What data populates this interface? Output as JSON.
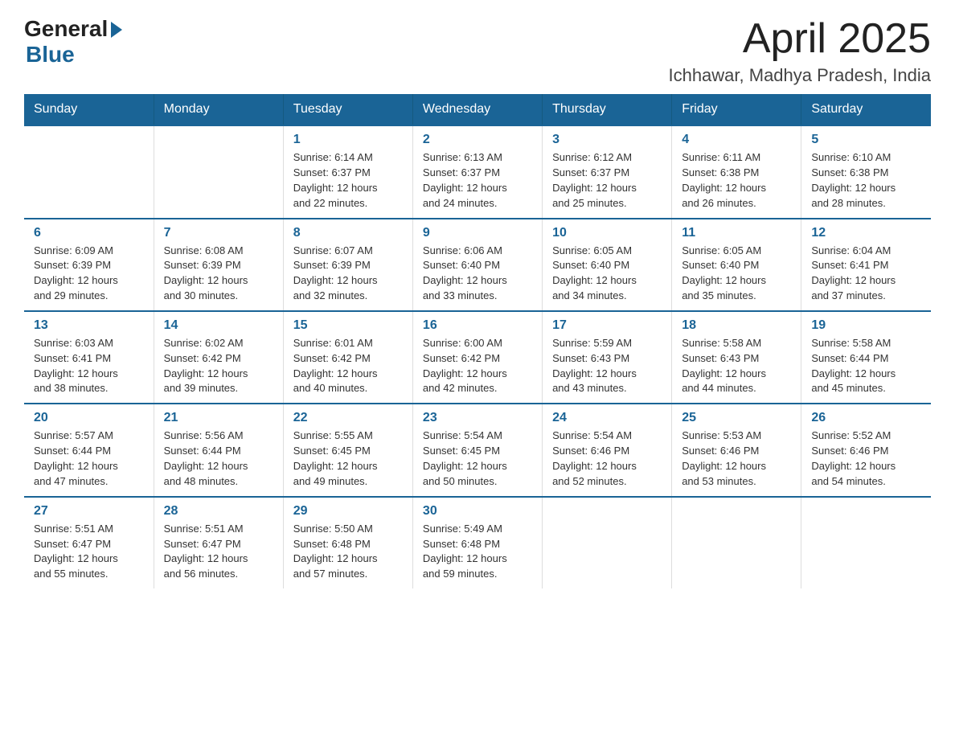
{
  "logo": {
    "general": "General",
    "blue": "Blue"
  },
  "title": {
    "month_year": "April 2025",
    "location": "Ichhawar, Madhya Pradesh, India"
  },
  "weekdays": [
    "Sunday",
    "Monday",
    "Tuesday",
    "Wednesday",
    "Thursday",
    "Friday",
    "Saturday"
  ],
  "weeks": [
    [
      {
        "day": "",
        "info": ""
      },
      {
        "day": "",
        "info": ""
      },
      {
        "day": "1",
        "info": "Sunrise: 6:14 AM\nSunset: 6:37 PM\nDaylight: 12 hours\nand 22 minutes."
      },
      {
        "day": "2",
        "info": "Sunrise: 6:13 AM\nSunset: 6:37 PM\nDaylight: 12 hours\nand 24 minutes."
      },
      {
        "day": "3",
        "info": "Sunrise: 6:12 AM\nSunset: 6:37 PM\nDaylight: 12 hours\nand 25 minutes."
      },
      {
        "day": "4",
        "info": "Sunrise: 6:11 AM\nSunset: 6:38 PM\nDaylight: 12 hours\nand 26 minutes."
      },
      {
        "day": "5",
        "info": "Sunrise: 6:10 AM\nSunset: 6:38 PM\nDaylight: 12 hours\nand 28 minutes."
      }
    ],
    [
      {
        "day": "6",
        "info": "Sunrise: 6:09 AM\nSunset: 6:39 PM\nDaylight: 12 hours\nand 29 minutes."
      },
      {
        "day": "7",
        "info": "Sunrise: 6:08 AM\nSunset: 6:39 PM\nDaylight: 12 hours\nand 30 minutes."
      },
      {
        "day": "8",
        "info": "Sunrise: 6:07 AM\nSunset: 6:39 PM\nDaylight: 12 hours\nand 32 minutes."
      },
      {
        "day": "9",
        "info": "Sunrise: 6:06 AM\nSunset: 6:40 PM\nDaylight: 12 hours\nand 33 minutes."
      },
      {
        "day": "10",
        "info": "Sunrise: 6:05 AM\nSunset: 6:40 PM\nDaylight: 12 hours\nand 34 minutes."
      },
      {
        "day": "11",
        "info": "Sunrise: 6:05 AM\nSunset: 6:40 PM\nDaylight: 12 hours\nand 35 minutes."
      },
      {
        "day": "12",
        "info": "Sunrise: 6:04 AM\nSunset: 6:41 PM\nDaylight: 12 hours\nand 37 minutes."
      }
    ],
    [
      {
        "day": "13",
        "info": "Sunrise: 6:03 AM\nSunset: 6:41 PM\nDaylight: 12 hours\nand 38 minutes."
      },
      {
        "day": "14",
        "info": "Sunrise: 6:02 AM\nSunset: 6:42 PM\nDaylight: 12 hours\nand 39 minutes."
      },
      {
        "day": "15",
        "info": "Sunrise: 6:01 AM\nSunset: 6:42 PM\nDaylight: 12 hours\nand 40 minutes."
      },
      {
        "day": "16",
        "info": "Sunrise: 6:00 AM\nSunset: 6:42 PM\nDaylight: 12 hours\nand 42 minutes."
      },
      {
        "day": "17",
        "info": "Sunrise: 5:59 AM\nSunset: 6:43 PM\nDaylight: 12 hours\nand 43 minutes."
      },
      {
        "day": "18",
        "info": "Sunrise: 5:58 AM\nSunset: 6:43 PM\nDaylight: 12 hours\nand 44 minutes."
      },
      {
        "day": "19",
        "info": "Sunrise: 5:58 AM\nSunset: 6:44 PM\nDaylight: 12 hours\nand 45 minutes."
      }
    ],
    [
      {
        "day": "20",
        "info": "Sunrise: 5:57 AM\nSunset: 6:44 PM\nDaylight: 12 hours\nand 47 minutes."
      },
      {
        "day": "21",
        "info": "Sunrise: 5:56 AM\nSunset: 6:44 PM\nDaylight: 12 hours\nand 48 minutes."
      },
      {
        "day": "22",
        "info": "Sunrise: 5:55 AM\nSunset: 6:45 PM\nDaylight: 12 hours\nand 49 minutes."
      },
      {
        "day": "23",
        "info": "Sunrise: 5:54 AM\nSunset: 6:45 PM\nDaylight: 12 hours\nand 50 minutes."
      },
      {
        "day": "24",
        "info": "Sunrise: 5:54 AM\nSunset: 6:46 PM\nDaylight: 12 hours\nand 52 minutes."
      },
      {
        "day": "25",
        "info": "Sunrise: 5:53 AM\nSunset: 6:46 PM\nDaylight: 12 hours\nand 53 minutes."
      },
      {
        "day": "26",
        "info": "Sunrise: 5:52 AM\nSunset: 6:46 PM\nDaylight: 12 hours\nand 54 minutes."
      }
    ],
    [
      {
        "day": "27",
        "info": "Sunrise: 5:51 AM\nSunset: 6:47 PM\nDaylight: 12 hours\nand 55 minutes."
      },
      {
        "day": "28",
        "info": "Sunrise: 5:51 AM\nSunset: 6:47 PM\nDaylight: 12 hours\nand 56 minutes."
      },
      {
        "day": "29",
        "info": "Sunrise: 5:50 AM\nSunset: 6:48 PM\nDaylight: 12 hours\nand 57 minutes."
      },
      {
        "day": "30",
        "info": "Sunrise: 5:49 AM\nSunset: 6:48 PM\nDaylight: 12 hours\nand 59 minutes."
      },
      {
        "day": "",
        "info": ""
      },
      {
        "day": "",
        "info": ""
      },
      {
        "day": "",
        "info": ""
      }
    ]
  ]
}
